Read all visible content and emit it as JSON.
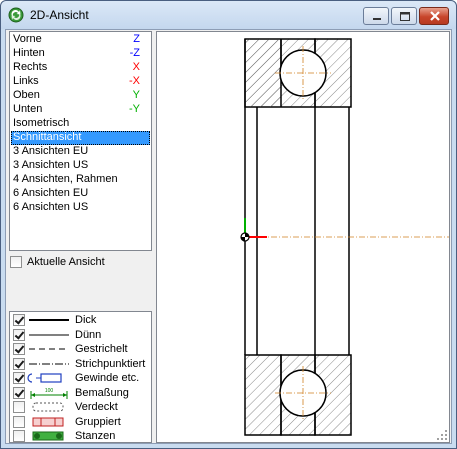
{
  "window": {
    "title": "2D-Ansicht",
    "app_icon": "recycle-icon",
    "buttons": [
      "minimize-icon",
      "maximize-icon",
      "close-icon"
    ]
  },
  "views": {
    "selected_index": 7,
    "items": [
      {
        "label": "Vorne",
        "axis": "Z",
        "axis_color": "#0000ff"
      },
      {
        "label": "Hinten",
        "axis": "-Z",
        "axis_color": "#0000ff"
      },
      {
        "label": "Rechts",
        "axis": "X",
        "axis_color": "#ff0000"
      },
      {
        "label": "Links",
        "axis": "-X",
        "axis_color": "#ff0000"
      },
      {
        "label": "Oben",
        "axis": "Y",
        "axis_color": "#00b000"
      },
      {
        "label": "Unten",
        "axis": "-Y",
        "axis_color": "#00b000"
      },
      {
        "label": "Isometrisch",
        "axis": "",
        "axis_color": ""
      },
      {
        "label": "Schnittansicht",
        "axis": "",
        "axis_color": ""
      },
      {
        "label": "3 Ansichten EU",
        "axis": "",
        "axis_color": ""
      },
      {
        "label": "3 Ansichten US",
        "axis": "",
        "axis_color": ""
      },
      {
        "label": "4 Ansichten, Rahmen",
        "axis": "",
        "axis_color": ""
      },
      {
        "label": "6 Ansichten EU",
        "axis": "",
        "axis_color": ""
      },
      {
        "label": "6 Ansichten US",
        "axis": "",
        "axis_color": ""
      }
    ]
  },
  "current_view": {
    "label": "Aktuelle Ansicht",
    "checked": false
  },
  "line_types": [
    {
      "label": "Dick",
      "checked": true,
      "icon": "thick-line-icon"
    },
    {
      "label": "Dünn",
      "checked": true,
      "icon": "thin-line-icon"
    },
    {
      "label": "Gestrichelt",
      "checked": true,
      "icon": "dashed-line-icon"
    },
    {
      "label": "Strichpunktiert",
      "checked": true,
      "icon": "dash-dot-line-icon"
    },
    {
      "label": "Gewinde etc.",
      "checked": true,
      "icon": "thread-icon"
    },
    {
      "label": "Bemaßung",
      "checked": true,
      "icon": "dimension-icon",
      "dimension_text": "100"
    },
    {
      "label": "Verdeckt",
      "checked": false,
      "icon": "hidden-icon"
    },
    {
      "label": "Gruppiert",
      "checked": false,
      "icon": "grouped-icon"
    },
    {
      "label": "Stanzen",
      "checked": false,
      "icon": "punch-icon"
    }
  ],
  "colors": {
    "selection": "#3399ff",
    "axis_x": "#ff0000",
    "axis_y": "#00b000",
    "centerline": "#d08020"
  }
}
